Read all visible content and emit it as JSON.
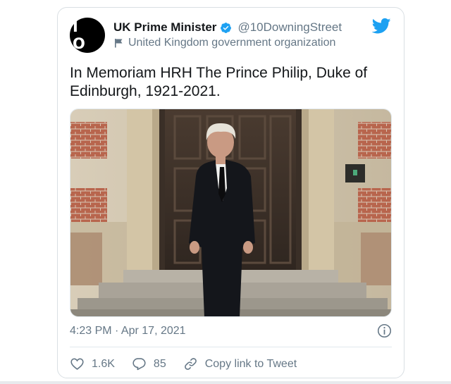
{
  "author": {
    "avatar_text": "I O",
    "display_name": "UK Prime Minister",
    "handle": "@10DowningStreet",
    "org_label": "United Kingdom government organization"
  },
  "tweet": {
    "text": "In Memoriam HRH The Prince Philip, Duke of Edinburgh, 1921-2021.",
    "timestamp": "4:23 PM · Apr 17, 2021"
  },
  "actions": {
    "likes": "1.6K",
    "replies": "85",
    "share_label": "Copy link to Tweet"
  },
  "icons": {
    "verified": "verified-badge-icon",
    "bird": "twitter-bird-icon",
    "info": "info-icon",
    "like": "heart-icon",
    "reply": "reply-icon",
    "share": "link-icon",
    "org": "flag-icon"
  },
  "colors": {
    "accent": "#1da1f2",
    "muted": "#657786",
    "text": "#14171a"
  }
}
